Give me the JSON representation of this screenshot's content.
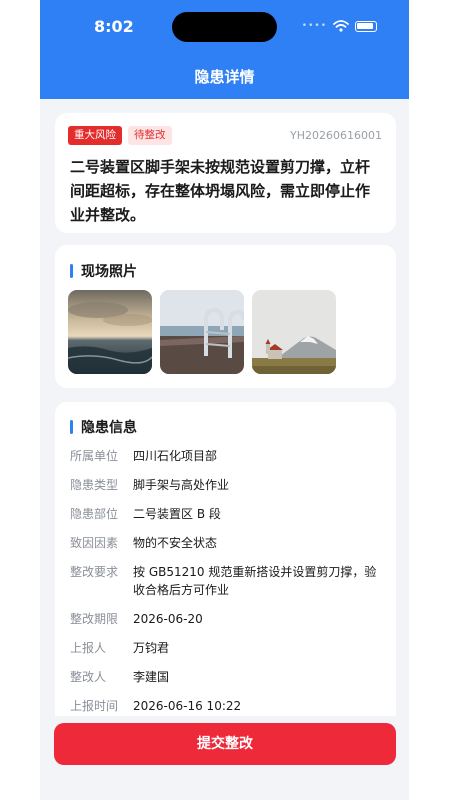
{
  "status_bar": {
    "time": "8:02"
  },
  "header": {
    "title": "隐患详情"
  },
  "summary": {
    "risk_tag": "重大风险",
    "status_tag": "待整改",
    "id": "YH20260616001",
    "description": "二号装置区脚手架未按规范设置剪刀撑，立杆间距超标，存在整体坍塌风险，需立即停止作业并整改。"
  },
  "photos": {
    "title": "现场照片",
    "items": [
      "seascape-photo",
      "pool-ladder-photo",
      "mountain-church-photo"
    ]
  },
  "info": {
    "title": "隐患信息",
    "rows": [
      {
        "label": "所属单位",
        "value": "四川石化项目部"
      },
      {
        "label": "隐患类型",
        "value": "脚手架与高处作业"
      },
      {
        "label": "隐患部位",
        "value": "二号装置区 B 段"
      },
      {
        "label": "致因因素",
        "value": "物的不安全状态"
      },
      {
        "label": "整改要求",
        "value": "按 GB51210 规范重新搭设并设置剪刀撑，验收合格后方可作业"
      },
      {
        "label": "整改期限",
        "value": "2026-06-20"
      },
      {
        "label": "上报人",
        "value": "万钧君"
      },
      {
        "label": "整改人",
        "value": "李建国"
      },
      {
        "label": "上报时间",
        "value": "2026-06-16 10:22"
      }
    ]
  },
  "actions": {
    "submit_label": "提交整改"
  },
  "colors": {
    "primary": "#2f80f5",
    "danger": "#ee2a3a",
    "tag_red": "#e32d2d",
    "tag_pink_bg": "#fde5e5"
  }
}
